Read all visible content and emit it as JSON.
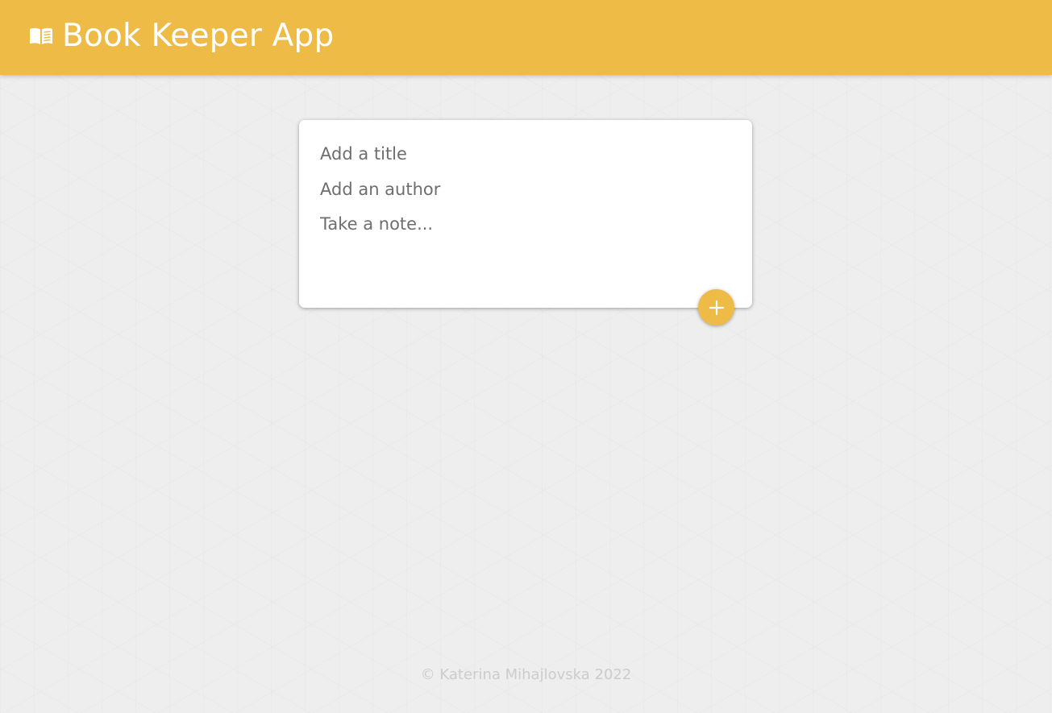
{
  "header": {
    "icon": "open-book-icon",
    "title": "Book Keeper App",
    "background_color": "#edbb46"
  },
  "note_form": {
    "title_placeholder": "Add a title",
    "author_placeholder": "Add an author",
    "note_placeholder": "Take a note...",
    "add_button_icon": "plus-icon"
  },
  "footer": {
    "text": "© Katerina Mihajlovska 2022"
  }
}
